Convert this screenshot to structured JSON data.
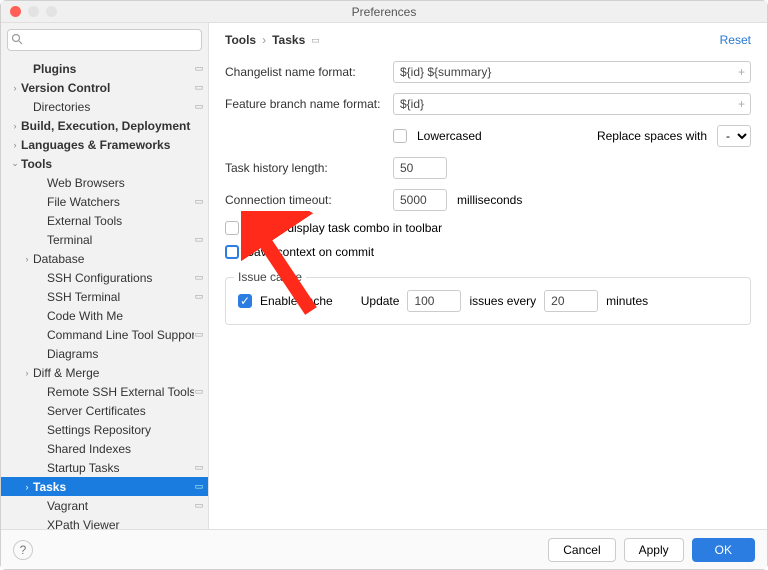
{
  "window": {
    "title": "Preferences"
  },
  "search": {
    "placeholder": ""
  },
  "sidebar": [
    {
      "label": "Plugins",
      "depth": 1,
      "bold": true,
      "arrow": "",
      "badge": "▭"
    },
    {
      "label": "Version Control",
      "depth": 0,
      "bold": true,
      "arrow": "›",
      "badge": "▭"
    },
    {
      "label": "Directories",
      "depth": 1,
      "bold": false,
      "arrow": "",
      "badge": "▭"
    },
    {
      "label": "Build, Execution, Deployment",
      "depth": 0,
      "bold": true,
      "arrow": "›",
      "badge": ""
    },
    {
      "label": "Languages & Frameworks",
      "depth": 0,
      "bold": true,
      "arrow": "›",
      "badge": ""
    },
    {
      "label": "Tools",
      "depth": 0,
      "bold": true,
      "arrow": "⌄",
      "badge": ""
    },
    {
      "label": "Web Browsers",
      "depth": 2,
      "bold": false,
      "arrow": "",
      "badge": ""
    },
    {
      "label": "File Watchers",
      "depth": 2,
      "bold": false,
      "arrow": "",
      "badge": "▭"
    },
    {
      "label": "External Tools",
      "depth": 2,
      "bold": false,
      "arrow": "",
      "badge": ""
    },
    {
      "label": "Terminal",
      "depth": 2,
      "bold": false,
      "arrow": "",
      "badge": "▭"
    },
    {
      "label": "Database",
      "depth": 1,
      "bold": false,
      "arrow": "›",
      "badge": ""
    },
    {
      "label": "SSH Configurations",
      "depth": 2,
      "bold": false,
      "arrow": "",
      "badge": "▭"
    },
    {
      "label": "SSH Terminal",
      "depth": 2,
      "bold": false,
      "arrow": "",
      "badge": "▭"
    },
    {
      "label": "Code With Me",
      "depth": 2,
      "bold": false,
      "arrow": "",
      "badge": ""
    },
    {
      "label": "Command Line Tool Support",
      "depth": 2,
      "bold": false,
      "arrow": "",
      "badge": "▭"
    },
    {
      "label": "Diagrams",
      "depth": 2,
      "bold": false,
      "arrow": "",
      "badge": ""
    },
    {
      "label": "Diff & Merge",
      "depth": 1,
      "bold": false,
      "arrow": "›",
      "badge": ""
    },
    {
      "label": "Remote SSH External Tools",
      "depth": 2,
      "bold": false,
      "arrow": "",
      "badge": "▭"
    },
    {
      "label": "Server Certificates",
      "depth": 2,
      "bold": false,
      "arrow": "",
      "badge": ""
    },
    {
      "label": "Settings Repository",
      "depth": 2,
      "bold": false,
      "arrow": "",
      "badge": ""
    },
    {
      "label": "Shared Indexes",
      "depth": 2,
      "bold": false,
      "arrow": "",
      "badge": ""
    },
    {
      "label": "Startup Tasks",
      "depth": 2,
      "bold": false,
      "arrow": "",
      "badge": "▭"
    },
    {
      "label": "Tasks",
      "depth": 1,
      "bold": true,
      "arrow": "›",
      "badge": "▭",
      "selected": true
    },
    {
      "label": "Vagrant",
      "depth": 2,
      "bold": false,
      "arrow": "",
      "badge": "▭"
    },
    {
      "label": "XPath Viewer",
      "depth": 2,
      "bold": false,
      "arrow": "",
      "badge": ""
    }
  ],
  "crumbs": {
    "a": "Tools",
    "b": "Tasks",
    "reset": "Reset"
  },
  "form": {
    "changelist_label": "Changelist name format:",
    "changelist_value": "${id} ${summary}",
    "branch_label": "Feature branch name format:",
    "branch_value": "${id}",
    "lowercased": "Lowercased",
    "replace_label": "Replace spaces with",
    "replace_value": "-",
    "history_label": "Task history length:",
    "history_value": "50",
    "timeout_label": "Connection timeout:",
    "timeout_value": "5000",
    "timeout_unit": "milliseconds",
    "always_display": "Always display task combo in toolbar",
    "save_context": "Save context on commit"
  },
  "cache": {
    "legend": "Issue cache",
    "enable": "Enable cache",
    "update": "Update",
    "count": "100",
    "mid": "issues every",
    "minutes_val": "20",
    "minutes_lbl": "minutes"
  },
  "footer": {
    "cancel": "Cancel",
    "apply": "Apply",
    "ok": "OK"
  }
}
